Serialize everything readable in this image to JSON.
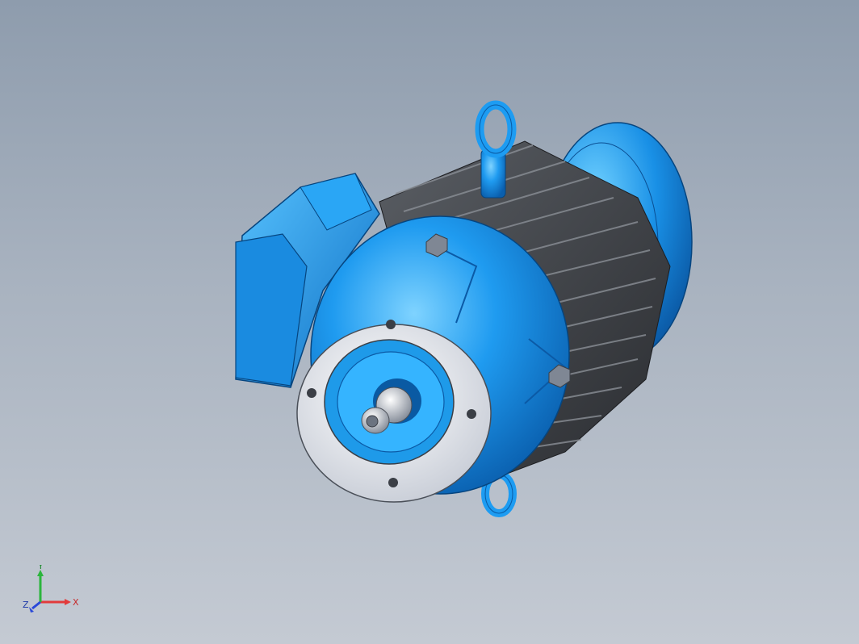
{
  "viewport": {
    "background_top": "#8e9cad",
    "background_bottom": "#c4cad3"
  },
  "model": {
    "body_color": "#1f8fe6",
    "fin_color": "#3c3f44",
    "flange_color": "#e9ecf2"
  },
  "triad": {
    "x_label": "X",
    "y_label": "Y",
    "z_label": "Z",
    "x_color": "#e23b3b",
    "y_color": "#2bb53c",
    "z_color": "#2a49d8"
  }
}
